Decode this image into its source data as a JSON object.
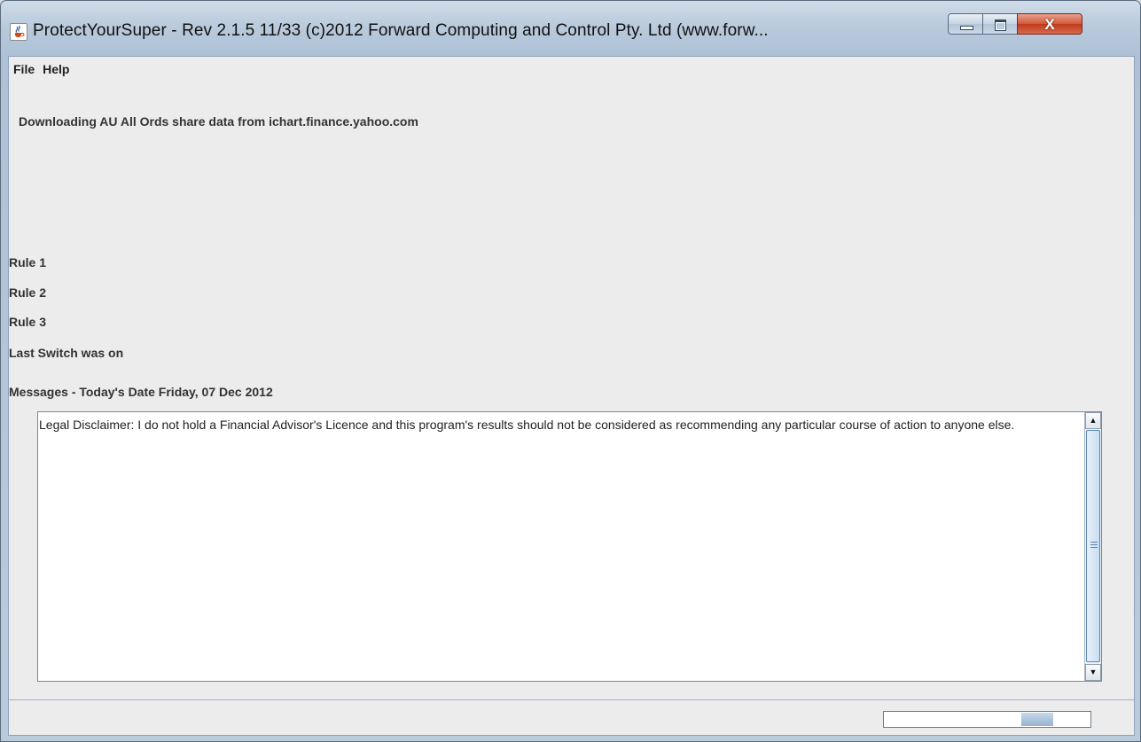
{
  "window": {
    "title": "ProtectYourSuper - Rev 2.1.5  11/33 (c)2012 Forward Computing and Control Pty. Ltd (www.forw...",
    "icon": "java-cup-icon",
    "caption_buttons": {
      "minimize": "minimize-icon",
      "maximize": "maximize-icon",
      "close": "X"
    }
  },
  "menu": {
    "items": [
      "File",
      "Help"
    ]
  },
  "status": {
    "download": "Downloading AU All Ords share data from ichart.finance.yahoo.com"
  },
  "rules": [
    "Rule 1",
    "Rule 2",
    "Rule 3"
  ],
  "last_switch": "Last Switch was on",
  "messages": {
    "header": "Messages - Today's Date Friday, 07 Dec 2012",
    "body": "Legal Disclaimer: I do not hold a Financial Advisor's Licence and this program's results should not be considered as recommending any particular course of action to anyone else."
  },
  "progress": {
    "indeterminate": true
  },
  "colors": {
    "title_bar": "#b9cadc",
    "client_bg": "#ececec",
    "close_button": "#c13a1c",
    "progress_fill": "#98b2d2"
  }
}
